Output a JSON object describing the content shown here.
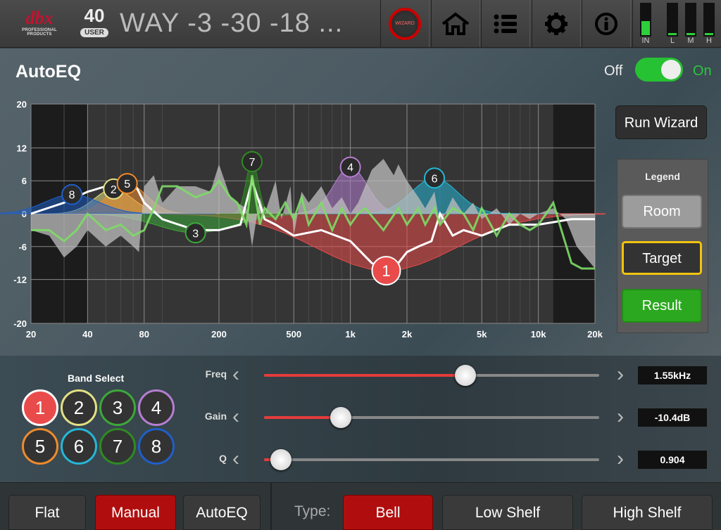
{
  "header": {
    "brand": "dbx",
    "brand_sub": "PROFESSIONAL PRODUCTS",
    "preset_number": "40",
    "preset_type": "USER",
    "preset_name": "WAY -3 -30 -18 ...",
    "wizard_label": "WIZARD",
    "meters": [
      {
        "label": "IN",
        "level": 0.45
      },
      {
        "label": "L",
        "level": 0.05
      },
      {
        "label": "M",
        "level": 0.05
      },
      {
        "label": "H",
        "level": 0.05
      }
    ],
    "meter_color": "#2dcf3a"
  },
  "title": "AutoEQ",
  "toggle": {
    "off_label": "Off",
    "on_label": "On",
    "state": "on"
  },
  "run_wizard": "Run Wizard",
  "legend": {
    "title": "Legend",
    "room": "Room",
    "target": "Target",
    "result": "Result"
  },
  "chart_data": {
    "type": "line",
    "xscale": "log",
    "xlim": [
      20,
      20000
    ],
    "ylim": [
      -20,
      20
    ],
    "x_ticks": [
      "20",
      "40",
      "80",
      "200",
      "500",
      "1k",
      "2k",
      "5k",
      "10k",
      "20k"
    ],
    "y_ticks": [
      "20",
      "12",
      "6",
      "0",
      "-6",
      "-12",
      "-20"
    ],
    "grid": true,
    "series": [
      {
        "name": "Room",
        "color": "#bfbfbf",
        "x": [
          20,
          25,
          30,
          35,
          40,
          50,
          60,
          70,
          75,
          80,
          90,
          100,
          120,
          150,
          180,
          200,
          230,
          250,
          280,
          300,
          330,
          350,
          400,
          430,
          480,
          500,
          550,
          600,
          700,
          800,
          900,
          1000,
          1100,
          1300,
          1500,
          1700,
          1800,
          2000,
          2300,
          2500,
          2800,
          3000,
          3500,
          4000,
          4500,
          5000,
          6000,
          7000,
          8000,
          9000,
          10000,
          12000,
          14000,
          16000,
          20000
        ],
        "y": [
          -3,
          -4,
          -8,
          -6,
          -3,
          -6,
          -4,
          -6,
          -7,
          5,
          7,
          2,
          5,
          5,
          4,
          9,
          3,
          2,
          1,
          -6,
          3,
          0,
          6,
          -1,
          5,
          -4,
          4,
          2,
          5,
          1,
          3,
          0,
          2,
          8,
          10,
          7,
          9,
          6,
          3,
          1,
          4,
          -2,
          3,
          0,
          2,
          -1,
          1,
          -2,
          0,
          -1,
          0,
          1,
          -1,
          -6,
          -10
        ]
      },
      {
        "name": "Target",
        "color": "#ffffff",
        "x": [
          20,
          30,
          40,
          50,
          60,
          70,
          80,
          100,
          150,
          200,
          260,
          300,
          350,
          400,
          500,
          700,
          1000,
          1300,
          1500,
          1800,
          2000,
          2300,
          2700,
          3000,
          3500,
          4000,
          5000,
          7000,
          10000,
          15000,
          20000
        ],
        "y": [
          0,
          2,
          4,
          5,
          6,
          6,
          2,
          -1,
          -3,
          -3,
          -2,
          6,
          -1,
          -2,
          -4,
          -3,
          -5,
          -9,
          -10,
          -9,
          -7,
          -6,
          -5,
          0,
          -4,
          -3,
          -4,
          -2,
          -2,
          -1,
          -1
        ]
      },
      {
        "name": "Result",
        "color": "#7ddc66",
        "x": [
          20,
          25,
          30,
          35,
          40,
          50,
          60,
          70,
          80,
          90,
          100,
          120,
          150,
          180,
          200,
          230,
          250,
          280,
          300,
          330,
          350,
          400,
          450,
          500,
          550,
          600,
          700,
          800,
          900,
          1000,
          1100,
          1200,
          1500,
          1800,
          2000,
          2300,
          2500,
          2800,
          3000,
          3500,
          4000,
          4500,
          5000,
          6000,
          7000,
          8000,
          9000,
          10000,
          11000,
          12000,
          13000,
          15000,
          17000,
          20000
        ],
        "y": [
          -3,
          -3,
          -5,
          -3,
          0,
          -3,
          -2,
          -4,
          -3,
          1,
          5,
          5,
          3,
          4,
          6,
          3,
          2,
          -2,
          7,
          -2,
          1,
          -1,
          2,
          -1,
          3,
          -2,
          2,
          -3,
          1,
          -2,
          0,
          1,
          -3,
          1,
          -2,
          1,
          -2,
          1,
          -2,
          1,
          0,
          -3,
          1,
          -4,
          0,
          -2,
          -3,
          -2,
          0,
          2,
          -2,
          -9,
          -10,
          -10
        ]
      }
    ],
    "bands": [
      {
        "id": "1",
        "freq": 1550,
        "gain": -10.4,
        "color": "#e94b4b"
      },
      {
        "id": "2",
        "freq": 55,
        "gain": 4.5,
        "color": "#e3e082"
      },
      {
        "id": "3",
        "freq": 150,
        "gain": -3.5,
        "color": "#3da83a"
      },
      {
        "id": "4",
        "freq": 1000,
        "gain": 8.5,
        "color": "#b57ed1"
      },
      {
        "id": "5",
        "freq": 65,
        "gain": 5.5,
        "color": "#ef8b2c"
      },
      {
        "id": "6",
        "freq": 2800,
        "gain": 6.5,
        "color": "#25b7d6"
      },
      {
        "id": "7",
        "freq": 300,
        "gain": 9.5,
        "color": "#2f8a22"
      },
      {
        "id": "8",
        "freq": 33,
        "gain": 3.5,
        "color": "#1f5fc7"
      }
    ]
  },
  "band_select": {
    "title": "Band Select",
    "labels": [
      "1",
      "2",
      "3",
      "4",
      "5",
      "6",
      "7",
      "8"
    ],
    "colors": [
      "#e94b4b",
      "#e3e082",
      "#3da83a",
      "#b57ed1",
      "#ef8b2c",
      "#25b7d6",
      "#2f8a22",
      "#1f5fc7"
    ],
    "selected": 0
  },
  "sliders": [
    {
      "label": "Freq",
      "fraction": 0.6,
      "value": "1.55kHz"
    },
    {
      "label": "Gain",
      "fraction": 0.23,
      "value": "-10.4dB"
    },
    {
      "label": "Q",
      "fraction": 0.05,
      "value": "0.904"
    }
  ],
  "mode_buttons": {
    "flat": "Flat",
    "manual": "Manual",
    "autoeq": "AutoEQ",
    "active": "manual"
  },
  "type": {
    "label": "Type:",
    "bell": "Bell",
    "low_shelf": "Low Shelf",
    "high_shelf": "High Shelf",
    "active": "bell"
  },
  "colors": {
    "accent": "#e53b3b",
    "toggle_on": "#27c233",
    "active_button": "#b00e0e"
  }
}
